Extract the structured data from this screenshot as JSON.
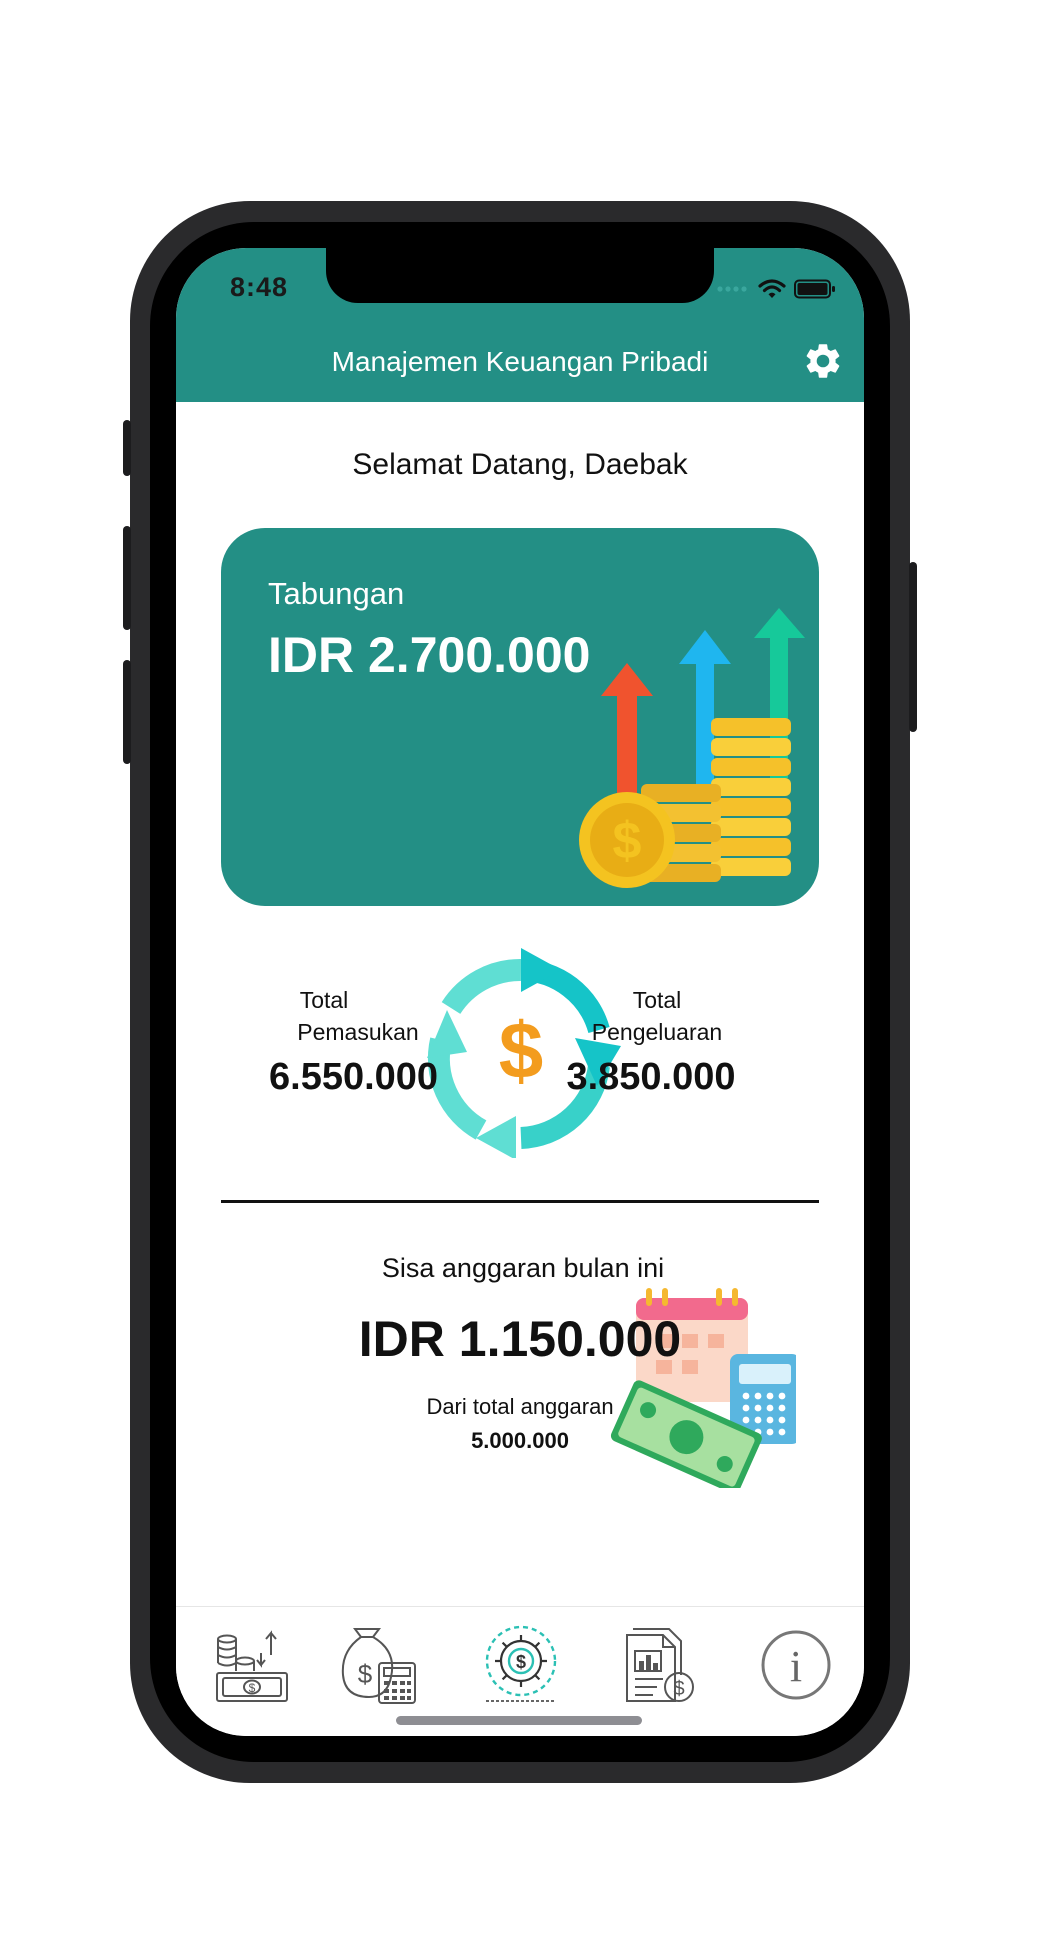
{
  "status_bar": {
    "time": "8:48"
  },
  "header": {
    "title": "Manajemen Keuangan Pribadi",
    "settings_icon": "gear-icon"
  },
  "welcome": "Selamat Datang, Daebak",
  "savings": {
    "label": "Tabungan",
    "amount": "IDR 2.700.000"
  },
  "income": {
    "label_line1": "Total",
    "label_line2": "Pemasukan",
    "value": "6.550.000"
  },
  "expense": {
    "label_line1": "Total",
    "label_line2": "Pengeluaran",
    "value": "3.850.000"
  },
  "budget": {
    "label": "Sisa anggaran bulan ini",
    "amount": "IDR 1.150.000",
    "of_label": "Dari total anggaran",
    "total": "5.000.000"
  },
  "tabs": [
    {
      "icon": "money-transactions-icon",
      "active": false
    },
    {
      "icon": "budget-calculator-icon",
      "active": false
    },
    {
      "icon": "finance-gear-icon",
      "active": true
    },
    {
      "icon": "financial-report-icon",
      "active": false
    },
    {
      "icon": "info-icon",
      "active": false
    }
  ],
  "colors": {
    "primary": "#238f85",
    "accent": "#2bc0b4"
  }
}
